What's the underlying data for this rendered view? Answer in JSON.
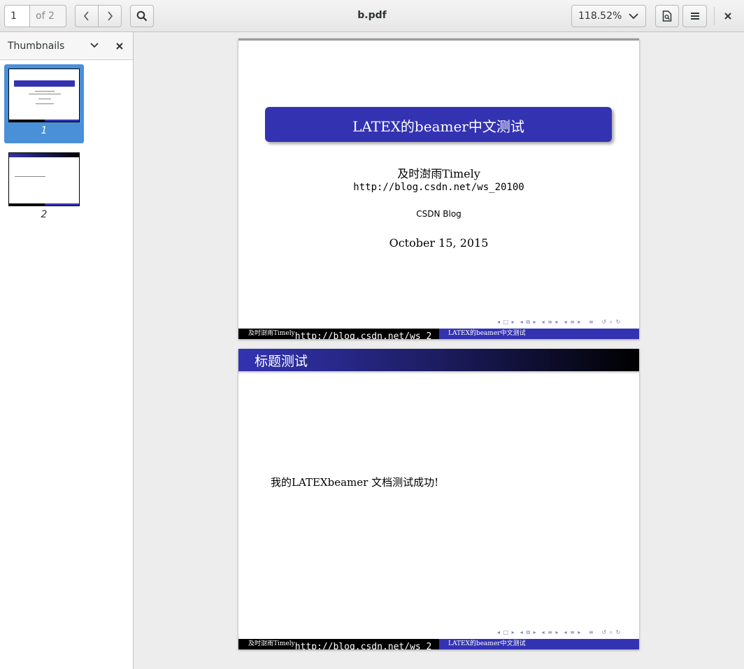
{
  "toolbar": {
    "page_number": "1",
    "page_of": "of 2",
    "document_title": "b.pdf",
    "zoom_level": "118.52%"
  },
  "sidebar": {
    "title": "Thumbnails",
    "thumbnails": [
      {
        "label": "1",
        "selected": true
      },
      {
        "label": "2",
        "selected": false
      }
    ]
  },
  "pages": [
    {
      "title": "LATEX的beamer中文测试",
      "author": "及时澍雨Timely",
      "url": "http://blog.csdn.net/ws_20100",
      "institute": "CSDN Blog",
      "date": "October 15, 2015",
      "footer_author": "及时澍雨Timely",
      "footer_url": "http://blog.csdn.net/ws_2",
      "footer_title": "LATEX的beamer中文测试"
    },
    {
      "frame_title": "标题测试",
      "body": "我的LATEXbeamer 文档测试成功!",
      "footer_author": "及时澍雨Timely",
      "footer_url": "http://blog.csdn.net/ws_2",
      "footer_title": "LATEX的beamer中文测试"
    }
  ],
  "colors": {
    "beamer_blue": "#3333b2",
    "selection": "#4a90d9"
  }
}
